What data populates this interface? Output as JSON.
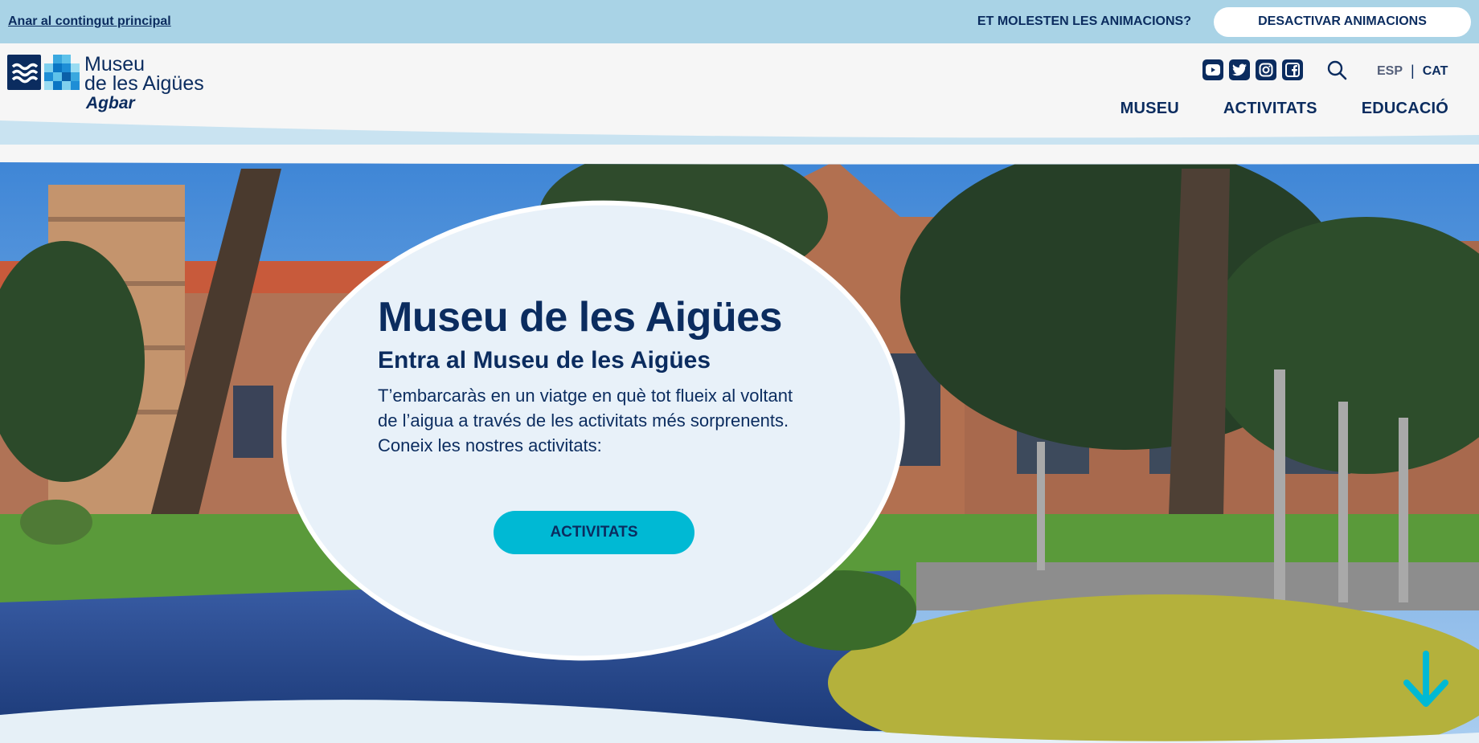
{
  "topbar": {
    "skip_link": "Anar al contingut principal",
    "animations_question": "ET MOLESTEN LES ANIMACIONS?",
    "animations_button": "DESACTIVAR ANIMACIONS"
  },
  "header": {
    "logo": {
      "line1": "Museu",
      "line2": "de les Aigües",
      "brand": "Agbar"
    },
    "social_icons": [
      "youtube-icon",
      "twitter-icon",
      "instagram-icon",
      "facebook-icon"
    ],
    "lang": {
      "esp": "ESP",
      "cat": "CAT"
    },
    "nav": [
      "MUSEU",
      "ACTIVITATS",
      "EDUCACIÓ"
    ]
  },
  "hero": {
    "title": "Museu de les Aigües",
    "subtitle": "Entra al Museu de les Aigües",
    "text1": "T’embarcaràs en un viatge en què tot flueix al voltant de l’aigua a través de les activitats més sorprenents.",
    "text2": "Coneix les nostres activitats:",
    "button": "ACTIVITATS"
  },
  "colors": {
    "navy": "#0b2c5f",
    "topbar": "#a9d3e6",
    "accent": "#00b9d4",
    "header_bg": "#f6f6f6"
  }
}
